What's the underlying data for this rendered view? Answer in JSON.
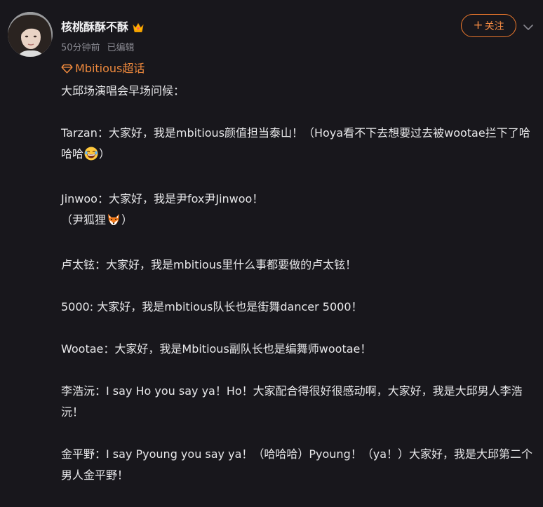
{
  "post": {
    "author": {
      "name": "核桃酥酥不酥",
      "badge_icon": "crown-icon"
    },
    "meta": {
      "time": "50分钟前",
      "edited": "已编辑"
    },
    "follow_label": "关注",
    "topic": "Mbitious超话",
    "paragraphs": {
      "p0": "大邱场演唱会早场问候：",
      "p1a": "Tarzan：大家好，我是mbitious颜值担当泰山！（Hoya看不下去想要过去被wootae拦下了哈哈哈",
      "p1b": "）",
      "p2a": "Jinwoo：大家好，我是尹fox尹Jinwoo！",
      "p2b": "（尹狐狸",
      "p2c": "）",
      "p3": "卢太铉：大家好，我是mbitious里什么事都要做的卢太铉！",
      "p4": "5000:  大家好，我是mbitious队长也是街舞dancer 5000！",
      "p5": "Wootae：大家好，我是Mbitious副队长也是编舞师wootae！",
      "p6": "李浩沅：I say Ho you say ya！Ho！大家配合得很好很感动啊，大家好，我是大邱男人李浩沅！",
      "p7": "金平野：I say Pyoung you say ya！（哈哈哈）Pyoung！（ya！）大家好，我是大邱第二个男人金平野！"
    }
  },
  "colors": {
    "background": "#18171c",
    "accent": "#f07a2c",
    "text": "#e8e8ea",
    "muted": "#8a8a92"
  },
  "icons": {
    "more": "chevron-down-icon",
    "topic": "diamond-icon",
    "laugh": "laughing-emoji-icon",
    "fox": "fox-emoji-icon"
  }
}
